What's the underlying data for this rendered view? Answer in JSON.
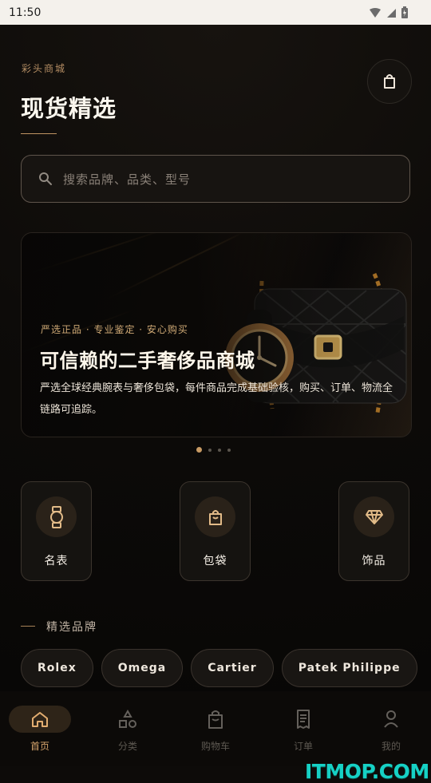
{
  "status_bar": {
    "time": "11:50"
  },
  "header": {
    "brand_label": "彩头商城",
    "title": "现货精选"
  },
  "search": {
    "placeholder": "搜索品牌、品类、型号"
  },
  "banner": {
    "tagline": "严选正品 · 专业鉴定 · 安心购买",
    "headline": "可信赖的二手奢侈品商城",
    "description": "严选全球经典腕表与奢侈包袋，每件商品完成基础验核，购买、订单、物流全链路可追踪。",
    "active_page": 1,
    "page_count": 4
  },
  "categories": [
    {
      "label": "名表",
      "icon": "watch-icon"
    },
    {
      "label": "包袋",
      "icon": "bag-icon"
    },
    {
      "label": "饰品",
      "icon": "diamond-icon"
    }
  ],
  "featured_brands": {
    "title": "精选品牌",
    "items": [
      "Rolex",
      "Omega",
      "Cartier",
      "Patek Philippe"
    ]
  },
  "tabs": [
    {
      "label": "首页",
      "icon": "home-icon",
      "active": true
    },
    {
      "label": "分类",
      "icon": "category-icon",
      "active": false
    },
    {
      "label": "购物车",
      "icon": "shopping-bag-icon",
      "active": false
    },
    {
      "label": "订单",
      "icon": "receipt-icon",
      "active": false
    },
    {
      "label": "我的",
      "icon": "user-icon",
      "active": false
    }
  ],
  "watermark": "ITMOP.COM",
  "colors": {
    "background": "#0d0b09",
    "accent_gold": "#c99b64",
    "card_background": "#151310",
    "text_primary": "#f2ece2",
    "watermark": "#16d1c5"
  }
}
